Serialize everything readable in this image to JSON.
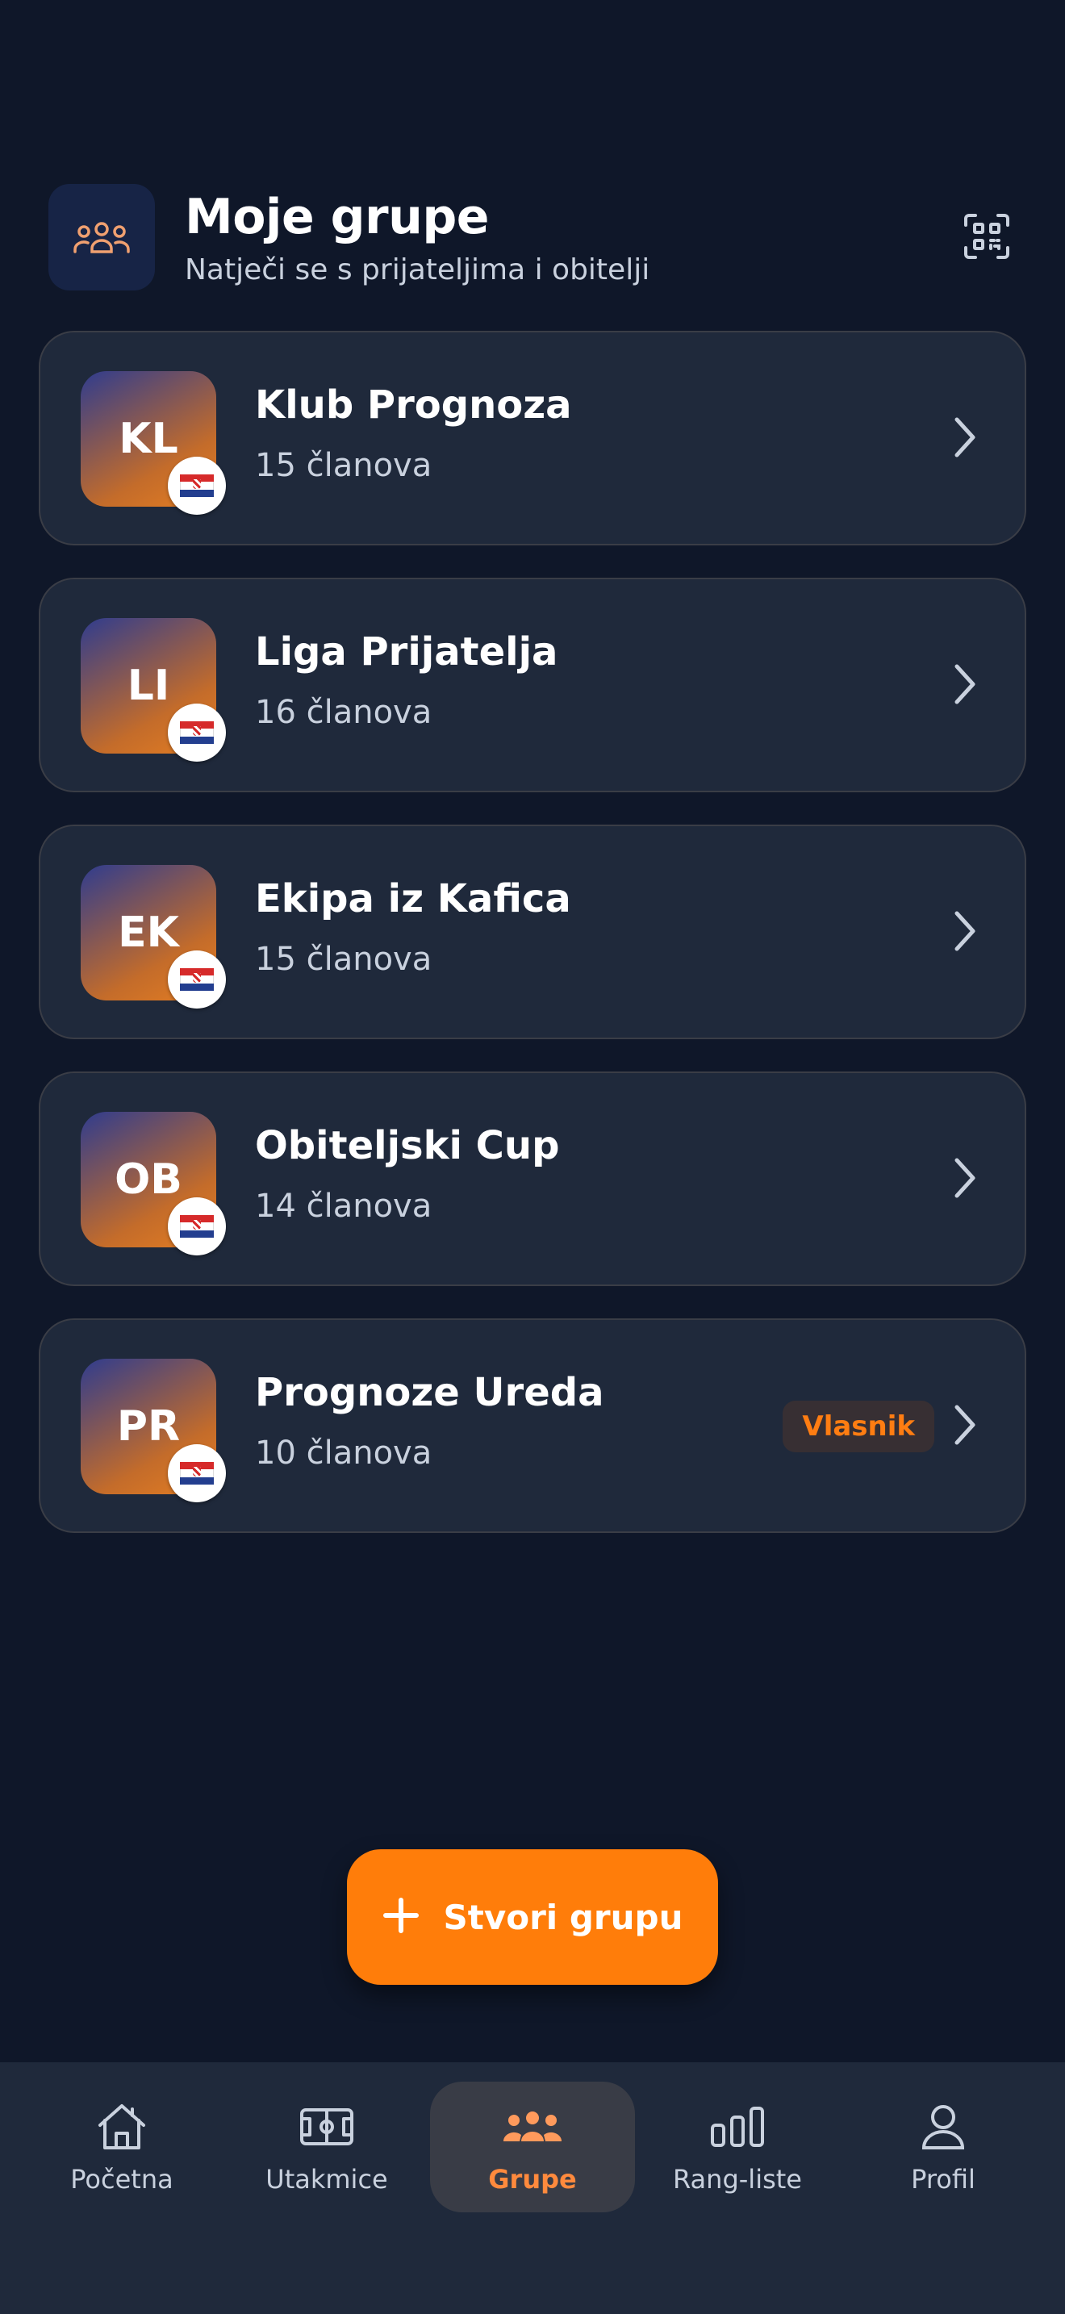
{
  "header": {
    "title": "Moje grupe",
    "subtitle": "Natječi se s prijateljima i obitelji",
    "icon": "users-group-icon",
    "action_icon": "qr-code-icon"
  },
  "groups": [
    {
      "initials": "KL",
      "name": "Klub Prognoza",
      "members": "15 članova",
      "flag": "croatia-flag"
    },
    {
      "initials": "LI",
      "name": "Liga Prijatelja",
      "members": "16 članova",
      "flag": "croatia-flag"
    },
    {
      "initials": "EK",
      "name": "Ekipa iz Kafica",
      "members": "15 članova",
      "flag": "croatia-flag"
    },
    {
      "initials": "OB",
      "name": "Obiteljski Cup",
      "members": "14 članova",
      "flag": "croatia-flag"
    },
    {
      "initials": "PR",
      "name": "Prognoze Ureda",
      "members": "10 članova",
      "flag": "croatia-flag",
      "badge": "Vlasnik"
    }
  ],
  "create_button": {
    "label": "Stvori grupu",
    "icon": "plus-icon"
  },
  "nav": [
    {
      "label": "Početna",
      "icon": "home-icon",
      "active": false
    },
    {
      "label": "Utakmice",
      "icon": "pitch-icon",
      "active": false
    },
    {
      "label": "Grupe",
      "icon": "users-group-icon",
      "active": true
    },
    {
      "label": "Rang-liste",
      "icon": "bar-chart-icon",
      "active": false
    },
    {
      "label": "Profil",
      "icon": "user-icon",
      "active": false
    }
  ],
  "colors": {
    "background": "#0f1729",
    "card": "#1f293b",
    "accent": "#ff7d0a",
    "text_secondary": "#c9d1de"
  }
}
